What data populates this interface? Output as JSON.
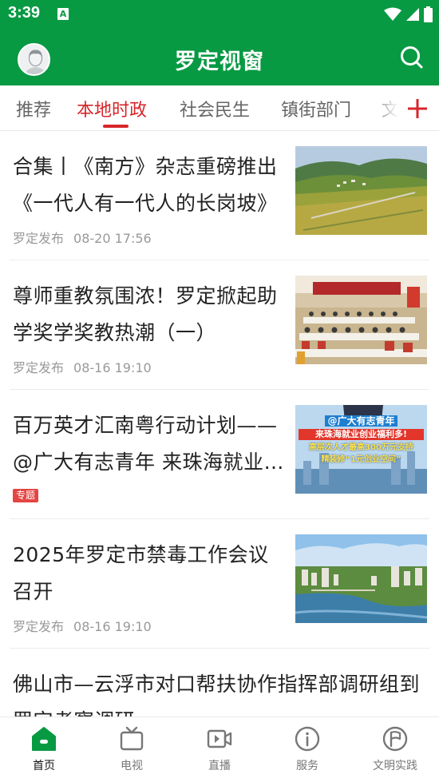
{
  "status_bar": {
    "time": "3:39",
    "notification_letter": "A"
  },
  "header": {
    "title": "罗定视窗"
  },
  "tabs": [
    {
      "label": "推荐",
      "active": false
    },
    {
      "label": "本地时政",
      "active": true
    },
    {
      "label": "社会民生",
      "active": false
    },
    {
      "label": "镇街部门",
      "active": false
    },
    {
      "label": "文体",
      "active": false
    }
  ],
  "articles": [
    {
      "title": "合集丨《南方》杂志重磅推出《一代人有一代人的长岗坡》",
      "source": "罗定发布",
      "time": "08-20 17:56"
    },
    {
      "title": "尊师重教氛围浓！罗定掀起助学奖学奖教热潮（一）",
      "source": "罗定发布",
      "time": "08-16 19:10"
    },
    {
      "title": "百万英才汇南粤行动计划——@广大有志青年  来珠海就业创业福利多！",
      "badge": "专题",
      "thumb_text": {
        "line1": "@广大有志青年",
        "line2": "来珠海就业创业福利多!",
        "line3": "高层次人才最高300万元支持",
        "line4": "精装修“1元创业空间”"
      }
    },
    {
      "title": "2025年罗定市禁毒工作会议召开",
      "source": "罗定发布",
      "time": "08-16 19:10"
    },
    {
      "title": "佛山市—云浮市对口帮扶协作指挥部调研组到罗定考察调研"
    }
  ],
  "bottom_nav": [
    {
      "label": "首页",
      "icon": "home-icon",
      "active": true
    },
    {
      "label": "电视",
      "icon": "tv-icon",
      "active": false
    },
    {
      "label": "直播",
      "icon": "live-video-icon",
      "active": false
    },
    {
      "label": "服务",
      "icon": "info-icon",
      "active": false
    },
    {
      "label": "文明实践",
      "icon": "flag-circle-icon",
      "active": false
    }
  ],
  "colors": {
    "brand_green": "#079a43",
    "accent_red": "#d6262b",
    "badge_red": "#e54542"
  }
}
